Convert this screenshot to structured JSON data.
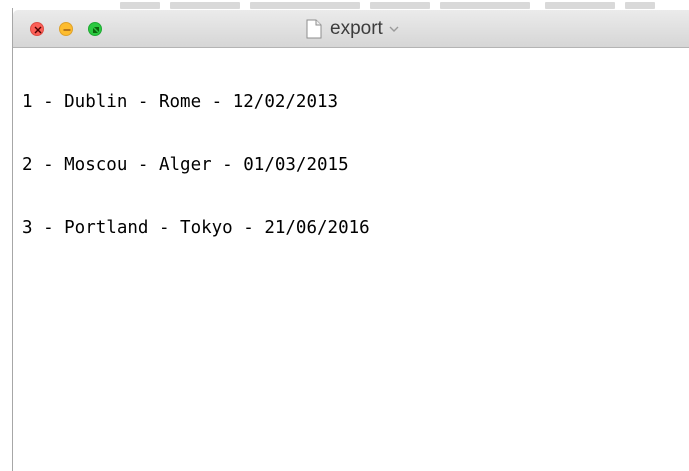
{
  "window": {
    "title": "export",
    "buttons": {
      "close": "close-window",
      "minimize": "minimize-window",
      "zoom": "zoom-window"
    },
    "document_icon": "document-icon",
    "title_menu_icon": "chevron-down-icon"
  },
  "editor": {
    "lines": [
      "1 - Dublin - Rome - 12/02/2013",
      "2 - Moscou - Alger - 01/03/2015",
      "3 - Portland - Tokyo - 21/06/2016"
    ]
  },
  "colors": {
    "close": "#fc5f57",
    "minimize": "#fdbc2e",
    "zoom": "#2ac940",
    "titlebar": "#e3e3e3",
    "text": "#000000"
  }
}
